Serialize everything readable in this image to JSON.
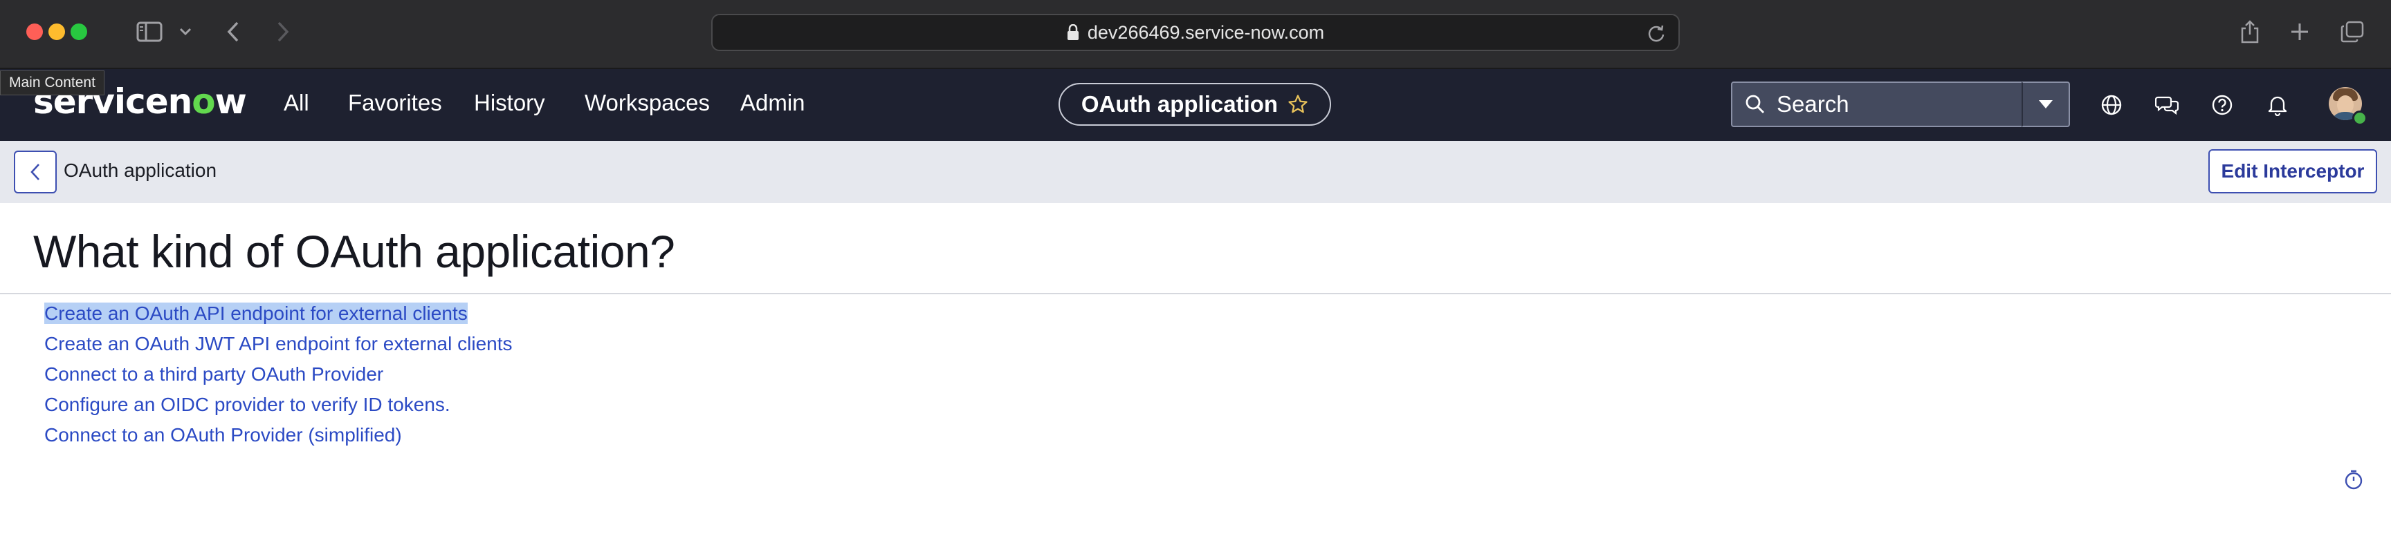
{
  "browser": {
    "url": "dev266469.service-now.com",
    "tooltip": "Main Content"
  },
  "header": {
    "logo_prefix": "servicen",
    "logo_o": "o",
    "logo_suffix": "w",
    "nav": [
      "All",
      "Favorites",
      "History",
      "Workspaces",
      "Admin"
    ],
    "context": "OAuth application",
    "search_placeholder": "Search"
  },
  "form": {
    "title": "OAuth application",
    "edit_interceptor": "Edit Interceptor"
  },
  "main": {
    "heading": "What kind of OAuth application?",
    "options": [
      "Create an OAuth API endpoint for external clients",
      "Create an OAuth JWT API endpoint for external clients",
      "Connect to a third party OAuth Provider",
      "Configure an OIDC provider to verify ID tokens.",
      "Connect to an OAuth Provider (simplified)"
    ],
    "selected_option_index": 0
  },
  "colors": {
    "header_bg": "#1e2130",
    "accent": "#3d4fb1",
    "link": "#2b4ac4",
    "logo_green": "#62d84e"
  }
}
